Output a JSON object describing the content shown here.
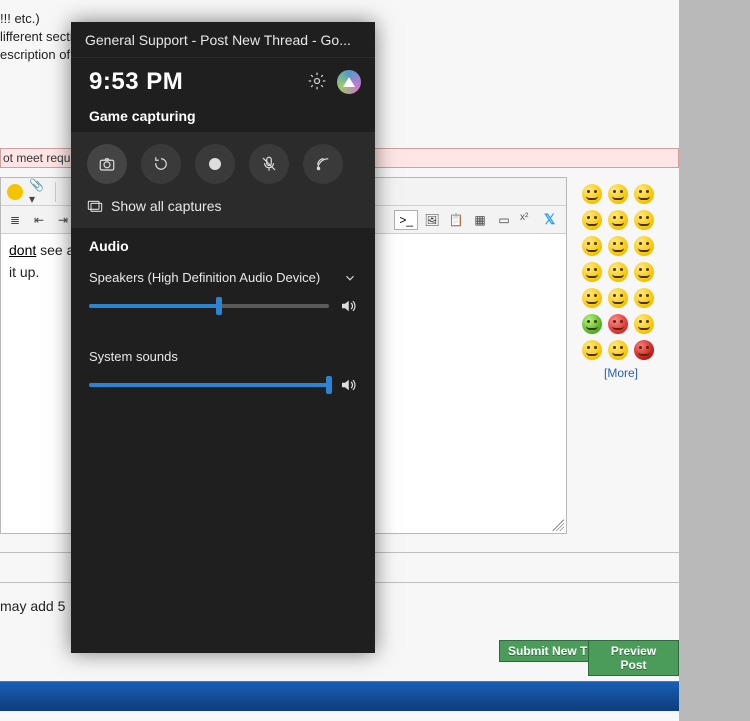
{
  "page": {
    "bg_lines": {
      "l1": "!!! etc.)",
      "l2": "lifferent sections for the same problem.",
      "l3": "escription of the issue to get the best help."
    },
    "notice": "ot meet requirem",
    "editor_text_1_a": "dont",
    "editor_text_1_b": " see ar",
    "editor_text_2": "it up.",
    "may_add": "may add 5",
    "submit_label": "Submit New Thread",
    "preview_label": "Preview Post",
    "emoji_more": "[More]",
    "code_prompt": ">_"
  },
  "gamebar": {
    "title": "General Support - Post New Thread - Go...",
    "time": "9:53 PM",
    "capturing_label": "Game capturing",
    "show_all": "Show all captures",
    "audio_label": "Audio",
    "speakers_label": "Speakers (High Definition Audio Device)",
    "speakers_pct": 54,
    "system_label": "System sounds",
    "system_pct": 100
  }
}
